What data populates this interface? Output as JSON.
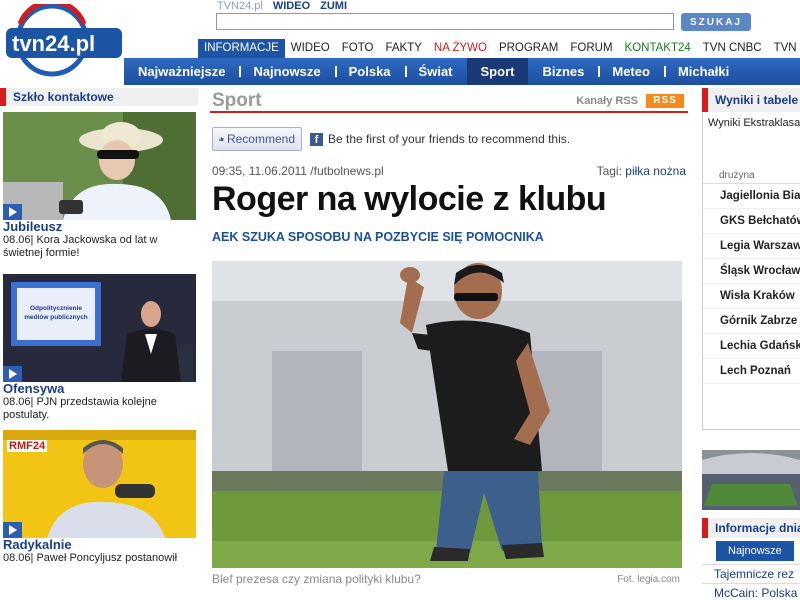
{
  "header": {
    "logo_text": "tvn24.pl",
    "top_links": [
      "TVN24.pl",
      "WIDEO",
      "ZUMI"
    ],
    "search": {
      "placeholder": "",
      "button_label": "SZUKAJ"
    },
    "sub_nav": [
      {
        "label": "INFORMACJE",
        "style": "active"
      },
      {
        "label": "WIDEO",
        "style": ""
      },
      {
        "label": "FOTO",
        "style": ""
      },
      {
        "label": "FAKTY",
        "style": ""
      },
      {
        "label": "NA ŻYWO",
        "style": "red"
      },
      {
        "label": "PROGRAM",
        "style": ""
      },
      {
        "label": "FORUM",
        "style": ""
      },
      {
        "label": "KONTAKT24",
        "style": "green"
      },
      {
        "label": "TVN CNBC",
        "style": ""
      },
      {
        "label": "TVN WARN",
        "style": ""
      }
    ],
    "main_nav": [
      {
        "label": "Najważniejsze",
        "active": false
      },
      {
        "label": "Najnowsze",
        "active": false
      },
      {
        "label": "Polska",
        "active": false
      },
      {
        "label": "Świat",
        "active": false
      },
      {
        "label": "Sport",
        "active": true
      },
      {
        "label": "Biznes",
        "active": false
      },
      {
        "label": "Meteo",
        "active": false
      },
      {
        "label": "Michałki",
        "active": false
      }
    ]
  },
  "left": {
    "section_title": "Szkło kontaktowe",
    "videos": [
      {
        "title": "Jubileusz",
        "desc": "08.06| Kora Jackowska od lat w świetnej formie!"
      },
      {
        "title": "Ofensywa",
        "desc": "08.06| PJN przedstawia kolejne postulaty.",
        "screen_text": "Odpolitycznienie mediów publicznych"
      },
      {
        "title": "Radykalnie",
        "desc": "08.06| Paweł Poncyljusz postanowił",
        "badge": "RMF24"
      }
    ]
  },
  "article": {
    "section": "Sport",
    "rss_label": "Kanały RSS",
    "rss_badge": "RSS",
    "recommend_label": "Recommend",
    "fb_text": "Be the first of your friends to recommend this.",
    "meta": "09:35, 11.06.2011 /futbolnews.pl",
    "tags_label": "Tagi:",
    "tag": "piłka nożna",
    "headline": "Roger na wylocie z klubu",
    "lead": "AEK SZUKA SPOSOBU NA POZBYCIE SIĘ POMOCNIKA",
    "caption": "Blef prezesa czy zmiana polityki klubu?",
    "credit": "Fot. legia.com"
  },
  "right": {
    "results_title": "Wyniki i tabele",
    "league_subtitle": "Wyniki Ekstraklasa",
    "col_label": "drużyna",
    "teams": [
      "Jagiellonia Białystok",
      "GKS Bełchatów",
      "Legia Warszawa",
      "Śląsk Wrocław",
      "Wisła Kraków",
      "Górnik Zabrze",
      "Lechia Gdańsk",
      "Lech Poznań"
    ],
    "info_title": "Informacje dnia",
    "info_tab": "Najnowsze",
    "info_links": [
      "Tajemnicze rez",
      "McCain: Polska"
    ]
  }
}
